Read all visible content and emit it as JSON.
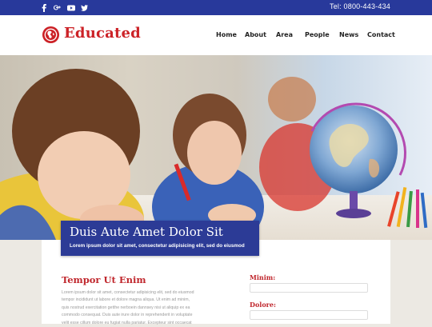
{
  "topbar": {
    "social_icons": [
      "facebook-icon",
      "google-plus-icon",
      "youtube-icon",
      "twitter-icon"
    ],
    "tel": "Tel: 0800-443-434"
  },
  "header": {
    "logo_text": "Educated",
    "nav": [
      "Home",
      "About",
      "Area",
      "People",
      "News",
      "Contact"
    ]
  },
  "hero": {
    "caption_title": "Duis Aute Amet Dolor Sit",
    "caption_subtitle": "Lorem ipsum dolor sit amet, consectetur adipisicing elit, sed do eiusmod"
  },
  "content": {
    "section_title": "Tempor Ut Enim",
    "body_lines": [
      "Lorem ipsum dolor sit amet, consectetur adipisicing elit, sed do eiusmod",
      "tempor incididunt ut labore et dolore magna aliqua. Ut enim ad minim,",
      "quis nostrud exercitation getthe nerboein dannsey nisi ut aliquip ex ea",
      "commodo consequat. Duis aute irure dolor in reprehenderit in voluptate",
      "velit esse cillum dolore eu fugiat nulla pariatur. Excepteur sint occaecat"
    ]
  },
  "form": {
    "label_1": "Minim:",
    "value_1": "",
    "label_2": "Dolore:",
    "value_2": ""
  },
  "colors": {
    "topbar": "#28399b",
    "brand_red": "#cc2227",
    "caption_bg": "#2c3b96"
  }
}
